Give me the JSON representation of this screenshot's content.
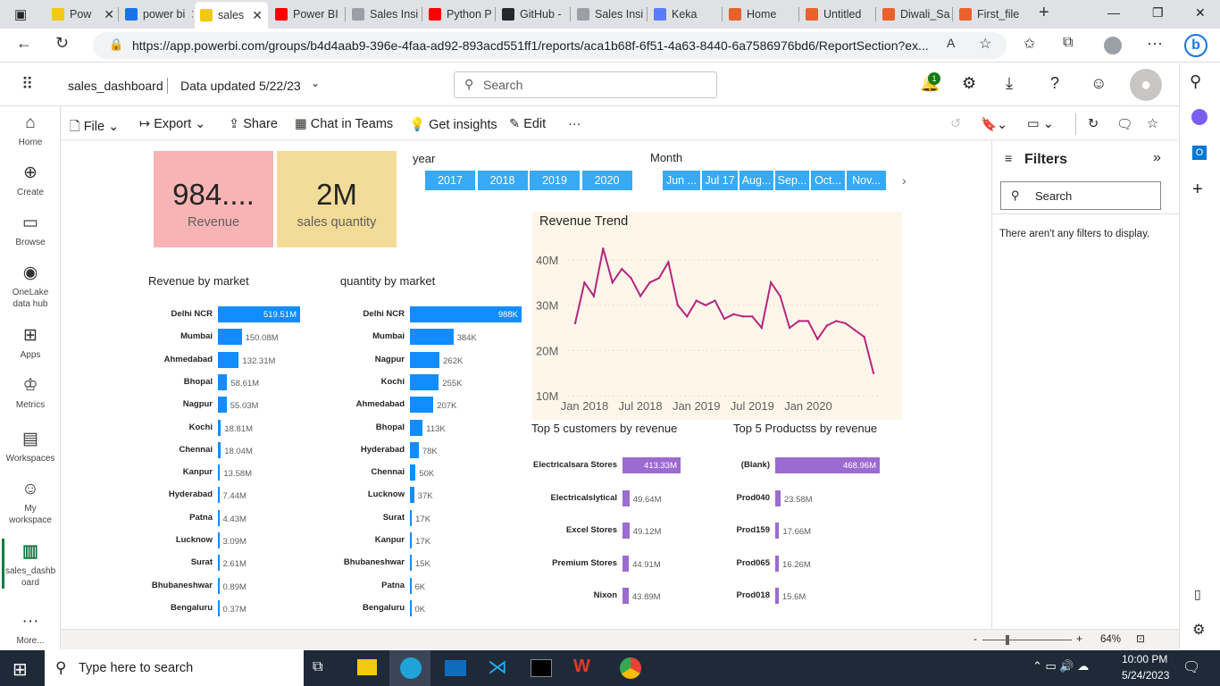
{
  "browser": {
    "tabs": [
      {
        "label": "Pow",
        "color": "#f2c811"
      },
      {
        "label": "power bi",
        "color": "#1a73e8"
      },
      {
        "label": "sales",
        "color": "#f2c811"
      },
      {
        "label": "Power BI",
        "color": "#ff0000"
      },
      {
        "label": "Sales Insi",
        "color": "#9aa0a6"
      },
      {
        "label": "Python P",
        "color": "#ff0000"
      },
      {
        "label": "GitHub -",
        "color": "#24292e"
      },
      {
        "label": "Sales Insi",
        "color": "#9aa0a6"
      },
      {
        "label": "Keka",
        "color": "#5b7cfa"
      },
      {
        "label": "Home",
        "color": "#e8622c"
      },
      {
        "label": "Untitled",
        "color": "#e8622c"
      },
      {
        "label": "Diwali_Sa",
        "color": "#e8622c"
      },
      {
        "label": "First_file",
        "color": "#e8622c"
      }
    ],
    "url": "https://app.powerbi.com/groups/b4d4aab9-396e-4faa-ad92-893acd551ff1/reports/aca1b68f-6f51-4a63-8440-6a7586976bd6/ReportSection?ex..."
  },
  "header": {
    "report_name": "sales_dashboard",
    "data_updated": "Data updated 5/22/23",
    "search_placeholder": "Search",
    "notification_count": "1"
  },
  "leftnav": [
    {
      "label": "Home",
      "icon": "home-icon"
    },
    {
      "label": "Create",
      "icon": "plus-circle-icon"
    },
    {
      "label": "Browse",
      "icon": "folder-icon"
    },
    {
      "label": "OneLake data hub",
      "icon": "onelake-icon"
    },
    {
      "label": "Apps",
      "icon": "apps-icon"
    },
    {
      "label": "Metrics",
      "icon": "trophy-icon"
    },
    {
      "label": "Workspaces",
      "icon": "workspaces-icon"
    },
    {
      "label": "My workspace",
      "icon": "my-workspace-icon"
    },
    {
      "label": "sales_dashb oard",
      "icon": "report-icon"
    },
    {
      "label": "More...",
      "icon": "more-icon"
    }
  ],
  "toolbar": {
    "file": "File",
    "export": "Export",
    "share": "Share",
    "chat": "Chat in Teams",
    "insights": "Get insights",
    "edit": "Edit",
    "more": "···"
  },
  "cards": {
    "revenue": {
      "value": "984....",
      "label": "Revenue",
      "color": "#f8b4b4"
    },
    "quantity": {
      "value": "2M",
      "label": "sales quantity",
      "color": "#f3dc97"
    }
  },
  "slicers": {
    "year_title": "year",
    "years": [
      "2017",
      "2018",
      "2019",
      "2020"
    ],
    "month_title": "Month",
    "months": [
      "Jun ...",
      "Jul 17",
      "Aug...",
      "Sep...",
      "Oct...",
      "Nov..."
    ]
  },
  "filters": {
    "title": "Filters",
    "search": "Search",
    "empty": "There aren't any filters to display."
  },
  "status": {
    "zoom": "64%"
  },
  "taskbar": {
    "search": "Type here to search",
    "time": "10:00 PM",
    "date": "5/24/2023"
  },
  "chart_data": [
    {
      "type": "bar",
      "title": "Revenue by market",
      "categories": [
        "Delhi NCR",
        "Mumbai",
        "Ahmedabad",
        "Bhopal",
        "Nagpur",
        "Kochi",
        "Chennai",
        "Kanpur",
        "Hyderabad",
        "Patna",
        "Lucknow",
        "Surat",
        "Bhubaneshwar",
        "Bengaluru"
      ],
      "values": [
        519.51,
        150.08,
        132.31,
        58.61,
        55.03,
        18.81,
        18.04,
        13.58,
        7.44,
        4.43,
        3.09,
        2.61,
        0.89,
        0.37
      ],
      "labels": [
        "519.51M",
        "150.08M",
        "132.31M",
        "58.61M",
        "55.03M",
        "18.81M",
        "18.04M",
        "13.58M",
        "7.44M",
        "4.43M",
        "3.09M",
        "2.61M",
        "0.89M",
        "0.37M"
      ],
      "color": "#118dff"
    },
    {
      "type": "bar",
      "title": "quantity by market",
      "categories": [
        "Delhi NCR",
        "Mumbai",
        "Nagpur",
        "Kochi",
        "Ahmedabad",
        "Bhopal",
        "Hyderabad",
        "Chennai",
        "Lucknow",
        "Surat",
        "Kanpur",
        "Bhubaneshwar",
        "Patna",
        "Bengaluru"
      ],
      "values": [
        988,
        384,
        262,
        255,
        207,
        113,
        78,
        50,
        37,
        17,
        17,
        15,
        6,
        0
      ],
      "labels": [
        "988K",
        "384K",
        "262K",
        "255K",
        "207K",
        "113K",
        "78K",
        "50K",
        "37K",
        "17K",
        "17K",
        "15K",
        "6K",
        "0K"
      ],
      "color": "#118dff"
    },
    {
      "type": "line",
      "title": "Revenue Trend",
      "x_ticks": [
        "Jan 2018",
        "Jul 2018",
        "Jan 2019",
        "Jul 2019",
        "Jan 2020"
      ],
      "y_ticks": [
        "40M",
        "30M",
        "20M",
        "10M"
      ],
      "ylim": [
        10,
        40
      ],
      "values": [
        26,
        35,
        32,
        42.5,
        35,
        38,
        36,
        32,
        35,
        36,
        39.5,
        30,
        27.5,
        31,
        30,
        31,
        27,
        28,
        27.5,
        27.5,
        25,
        35,
        32,
        25,
        26.5,
        26.5,
        22.5,
        25.5,
        26.5,
        26,
        24.5,
        23,
        15
      ],
      "color": "#b5267e",
      "background": "#fdf6e9"
    },
    {
      "type": "bar",
      "title": "Top 5 customers by revenue",
      "categories": [
        "Electricalsara Stores",
        "Electricalslytical",
        "Excel Stores",
        "Premium Stores",
        "Nixon"
      ],
      "values": [
        413.33,
        49.64,
        49.12,
        44.91,
        43.89
      ],
      "labels": [
        "413.33M",
        "49.64M",
        "49.12M",
        "44.91M",
        "43.89M"
      ],
      "color": "#9b6bd1"
    },
    {
      "type": "bar",
      "title": "Top 5 Productss by revenue",
      "categories": [
        "(Blank)",
        "Prod040",
        "Prod159",
        "Prod065",
        "Prod018"
      ],
      "values": [
        468.96,
        23.58,
        17.66,
        16.26,
        15.6
      ],
      "labels": [
        "468.96M",
        "23.58M",
        "17.66M",
        "16.26M",
        "15.6M"
      ],
      "color": "#9b6bd1"
    }
  ]
}
